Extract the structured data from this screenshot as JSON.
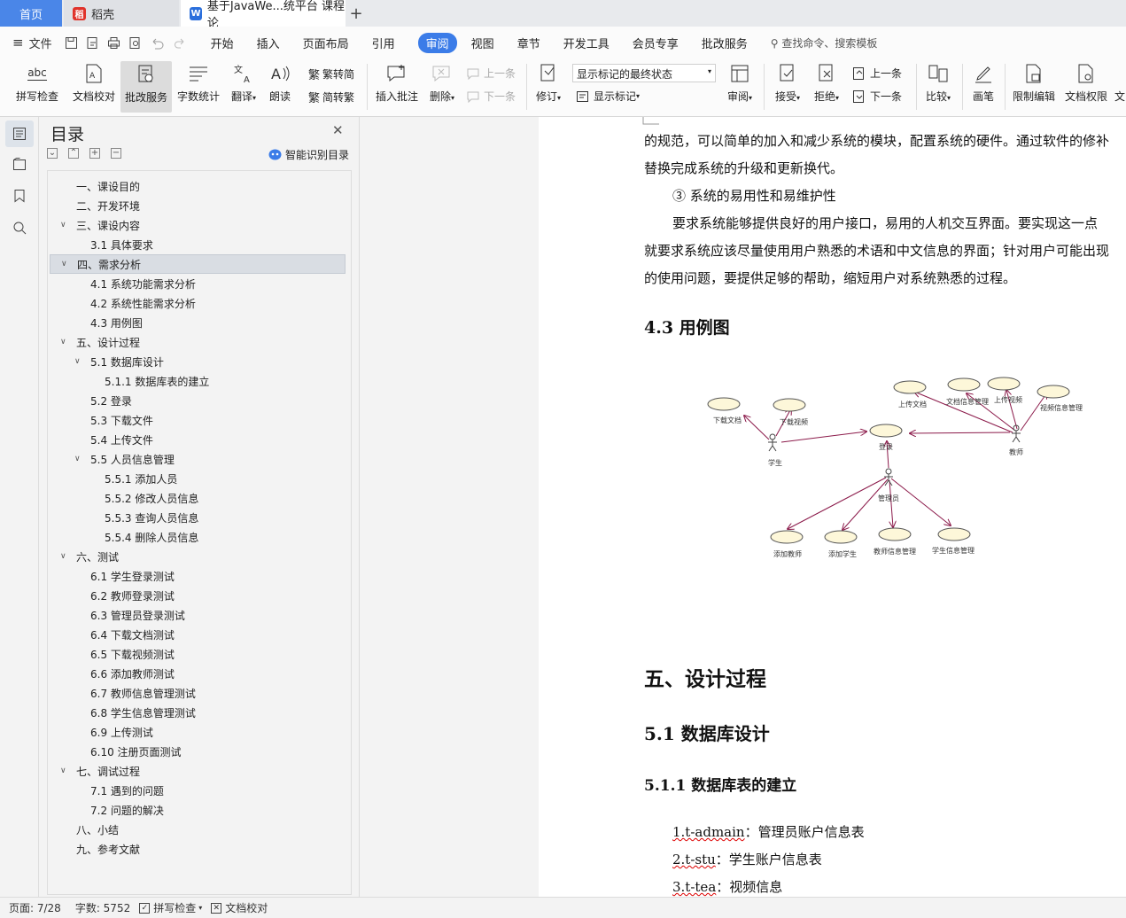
{
  "tabs": {
    "home": "首页",
    "daoke": "稻壳",
    "doc": "基于JavaWe...统平台 课程论"
  },
  "menu": {
    "file": "文件",
    "items": [
      "开始",
      "插入",
      "页面布局",
      "引用",
      "审阅",
      "视图",
      "章节",
      "开发工具",
      "会员专享",
      "批改服务"
    ],
    "active_index": 4,
    "search": "查找命令、搜索模板"
  },
  "ribbon": {
    "spell": "拼写检查",
    "spell_icon_text": "abc",
    "doccheck": "文档校对",
    "grading": "批改服务",
    "wordcount": "字数统计",
    "translate": "翻译",
    "read": "朗读",
    "trad": "繁转简",
    "simp": "简转繁",
    "insert_comment": "插入批注",
    "delete": "删除",
    "prev": "上一条",
    "next": "下一条",
    "revise": "修订",
    "markup_state": "显示标记的最终状态",
    "show_markup": "显示标记",
    "review": "审阅",
    "accept": "接受",
    "reject": "拒绝",
    "prev2": "上一条",
    "next2": "下一条",
    "compare": "比较",
    "pen": "画笔",
    "restrict": "限制编辑",
    "perm": "文档权限",
    "more": "文"
  },
  "toc": {
    "title": "目录",
    "smart": "智能识别目录",
    "items": [
      {
        "text": "一、课设目的",
        "level": 1,
        "arrow": ""
      },
      {
        "text": "二、开发环境",
        "level": 1,
        "arrow": ""
      },
      {
        "text": "三、课设内容",
        "level": 1,
        "arrow": "v"
      },
      {
        "text": "3.1 具体要求",
        "level": 2,
        "arrow": ""
      },
      {
        "text": "四、需求分析",
        "level": 1,
        "arrow": "v",
        "selected": true
      },
      {
        "text": "4.1 系统功能需求分析",
        "level": 2,
        "arrow": ""
      },
      {
        "text": "4.2 系统性能需求分析",
        "level": 2,
        "arrow": ""
      },
      {
        "text": "4.3 用例图",
        "level": 2,
        "arrow": ""
      },
      {
        "text": "五、设计过程",
        "level": 1,
        "arrow": "v"
      },
      {
        "text": "5.1 数据库设计",
        "level": 2,
        "arrow": "v"
      },
      {
        "text": "5.1.1 数据库表的建立",
        "level": 3,
        "arrow": ""
      },
      {
        "text": "5.2 登录",
        "level": 2,
        "arrow": ""
      },
      {
        "text": "5.3 下载文件",
        "level": 2,
        "arrow": ""
      },
      {
        "text": "5.4 上传文件",
        "level": 2,
        "arrow": ""
      },
      {
        "text": "5.5 人员信息管理",
        "level": 2,
        "arrow": "v"
      },
      {
        "text": "5.5.1 添加人员",
        "level": 3,
        "arrow": ""
      },
      {
        "text": "5.5.2 修改人员信息",
        "level": 3,
        "arrow": ""
      },
      {
        "text": "5.5.3 查询人员信息",
        "level": 3,
        "arrow": ""
      },
      {
        "text": "5.5.4 删除人员信息",
        "level": 3,
        "arrow": ""
      },
      {
        "text": "六、测试",
        "level": 1,
        "arrow": "v"
      },
      {
        "text": "6.1 学生登录测试",
        "level": 2,
        "arrow": ""
      },
      {
        "text": "6.2 教师登录测试",
        "level": 2,
        "arrow": ""
      },
      {
        "text": "6.3 管理员登录测试",
        "level": 2,
        "arrow": ""
      },
      {
        "text": "6.4 下载文档测试",
        "level": 2,
        "arrow": ""
      },
      {
        "text": "6.5 下载视频测试",
        "level": 2,
        "arrow": ""
      },
      {
        "text": "6.6 添加教师测试",
        "level": 2,
        "arrow": ""
      },
      {
        "text": "6.7 教师信息管理测试",
        "level": 2,
        "arrow": ""
      },
      {
        "text": "6.8 学生信息管理测试",
        "level": 2,
        "arrow": ""
      },
      {
        "text": "6.9 上传测试",
        "level": 2,
        "arrow": ""
      },
      {
        "text": "6.10 注册页面测试",
        "level": 2,
        "arrow": ""
      },
      {
        "text": "七、调试过程",
        "level": 1,
        "arrow": "v"
      },
      {
        "text": "7.1 遇到的问题",
        "level": 2,
        "arrow": ""
      },
      {
        "text": "7.2 问题的解决",
        "level": 2,
        "arrow": ""
      },
      {
        "text": "八、小结",
        "level": 1,
        "arrow": ""
      },
      {
        "text": "九、参考文献",
        "level": 1,
        "arrow": ""
      }
    ]
  },
  "doc": {
    "p1": "的规范，可以简单的加入和减少系统的模块，配置系统的硬件。通过软件的修补",
    "p2": "替换完成系统的升级和更新换代。",
    "p3": "③  系统的易用性和易维护性",
    "p4": "要求系统能够提供良好的用户接口，易用的人机交互界面。要实现这一点",
    "p5": "就要求系统应该尽量使用用户熟悉的术语和中文信息的界面；针对用户可能出现",
    "p6": "的使用问题，要提供足够的帮助，缩短用户对系统熟悉的过程。",
    "h43": "4.3 用例图",
    "h5": "五、设计过程",
    "h51": "5.1 数据库设计",
    "h511": "5.1.1 数据库表的建立",
    "t1a": "1.t-admain",
    "t1b": "：管理员账户信息表",
    "t2a": "2.t-stu",
    "t2b": "：学生账户信息表",
    "t3a": "3.t-tea",
    "t3b": "：视频信息"
  },
  "uml": {
    "student": "学生",
    "teacher": "教师",
    "admin": "管理员",
    "login": "登录",
    "dl_doc": "下载文档",
    "dl_video": "下载视频",
    "up_doc": "上传文档",
    "docinfo": "文档信息管理",
    "up_video": "上传视频",
    "videoinfo": "视频信息管理",
    "add_teacher": "添加教师",
    "add_student": "添加学生",
    "teacherinfo": "教师信息管理",
    "studentinfo": "学生信息管理"
  },
  "status": {
    "page": "页面: 7/28",
    "words": "字数: 5752",
    "spell": "拼写检查",
    "proof": "文档校对"
  },
  "colors": {
    "accent": "#3b7ce8",
    "uml_arrow": "#8b1a4a",
    "usecase_fill": "#fdf7d9"
  }
}
